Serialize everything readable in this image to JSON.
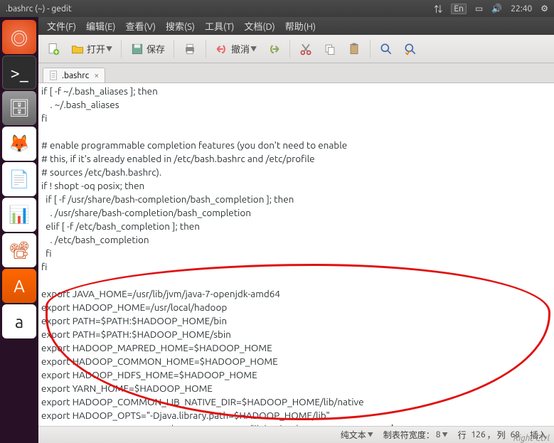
{
  "topbar": {
    "title": ".bashrc (~) - gedit",
    "lang": "En",
    "time": "22:40"
  },
  "menubar": {
    "file": "文件(F)",
    "edit": "编辑(E)",
    "view": "查看(V)",
    "search": "搜索(S)",
    "tools": "工具(T)",
    "documents": "文档(D)",
    "help": "帮助(H)"
  },
  "toolbar": {
    "open": "打开",
    "save": "保存",
    "undo": "撤消"
  },
  "tab": {
    "name": ".bashrc"
  },
  "editor": {
    "lines": [
      "if [ -f ~/.bash_aliases ]; then",
      "    . ~/.bash_aliases",
      "fi",
      "",
      "# enable programmable completion features (you don't need to enable",
      "# this, if it's already enabled in /etc/bash.bashrc and /etc/profile",
      "# sources /etc/bash.bashrc).",
      "if ! shopt -oq posix; then",
      "  if [ -f /usr/share/bash-completion/bash_completion ]; then",
      "    . /usr/share/bash-completion/bash_completion",
      "  elif [ -f /etc/bash_completion ]; then",
      "    . /etc/bash_completion",
      "  fi",
      "fi",
      "",
      "export JAVA_HOME=/usr/lib/jvm/java-7-openjdk-amd64",
      "export HADOOP_HOME=/usr/local/hadoop",
      "export PATH=$PATH:$HADOOP_HOME/bin",
      "export PATH=$PATH:$HADOOP_HOME/sbin",
      "export HADOOP_MAPRED_HOME=$HADOOP_HOME",
      "export HADOOP_COMMON_HOME=$HADOOP_HOME",
      "export HADOOP_HDFS_HOME=$HADOOP_HOME",
      "export YARN_HOME=$HADOOP_HOME",
      "export HADOOP_COMMON_LIB_NATIVE_DIR=$HADOOP_HOME/lib/native",
      "export HADOOP_OPTS=\"-Djava.library.path=$HADOOP_HOME/lib\"",
      "export JAVA_LIBRARY_PATH=$HADOOP_HOME/lib/native:$JAVA_LIBRARY_PATH"
    ]
  },
  "statusbar": {
    "lang": "纯文本",
    "tabwidth_label": "制表符宽度：",
    "tabwidth_value": "8",
    "pos_line_label": "行",
    "pos_line": "126",
    "pos_col_label": "列",
    "pos_col": "68",
    "insert": "插入"
  },
  "overlay": {
    "right_ctrl": "Right Ctrl"
  }
}
